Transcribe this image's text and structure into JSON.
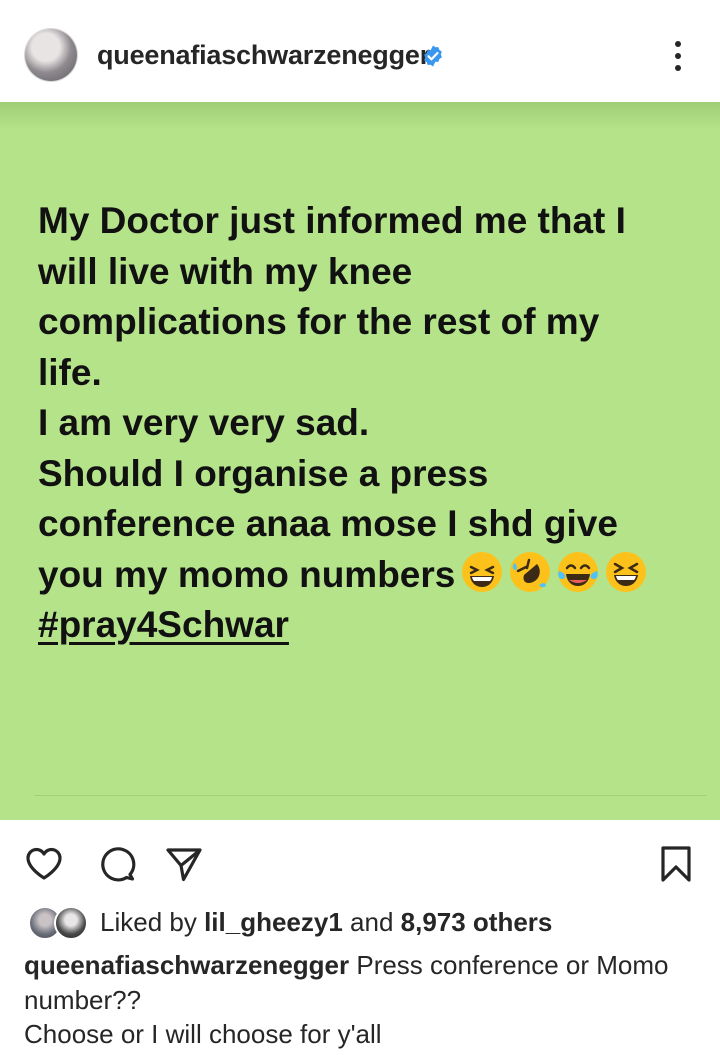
{
  "header": {
    "username": "queenafiaschwarzenegger",
    "verified_icon": "verified-badge-icon",
    "more_icon": "more-options-icon",
    "verified_color": "#3897f0"
  },
  "post": {
    "background": "#b5e38a",
    "lines": [
      "My Doctor just informed me that I",
      "will live with my knee",
      "complications for the rest of my",
      "life.",
      "I am very very sad.",
      "Should I organise a press",
      "conference anaa mose I shd give",
      "you my momo numbers"
    ],
    "emojis": [
      "grinning-squinting-face-icon",
      "rolling-on-floor-laughing-icon",
      "face-with-tears-of-joy-icon",
      "laughing-face-icon"
    ],
    "hashtag": "#pray4Schwar"
  },
  "actions": {
    "like_icon": "heart-icon",
    "comment_icon": "comment-icon",
    "share_icon": "paper-plane-icon",
    "save_icon": "bookmark-icon"
  },
  "likes": {
    "prefix": "Liked by ",
    "user": "lil_gheezy1",
    "middle": " and ",
    "count": "8,973 others"
  },
  "caption": {
    "username": "queenafiaschwarzenegger",
    "text": " Press conference or Momo number??",
    "line2": "Choose or I will choose for y'all"
  }
}
